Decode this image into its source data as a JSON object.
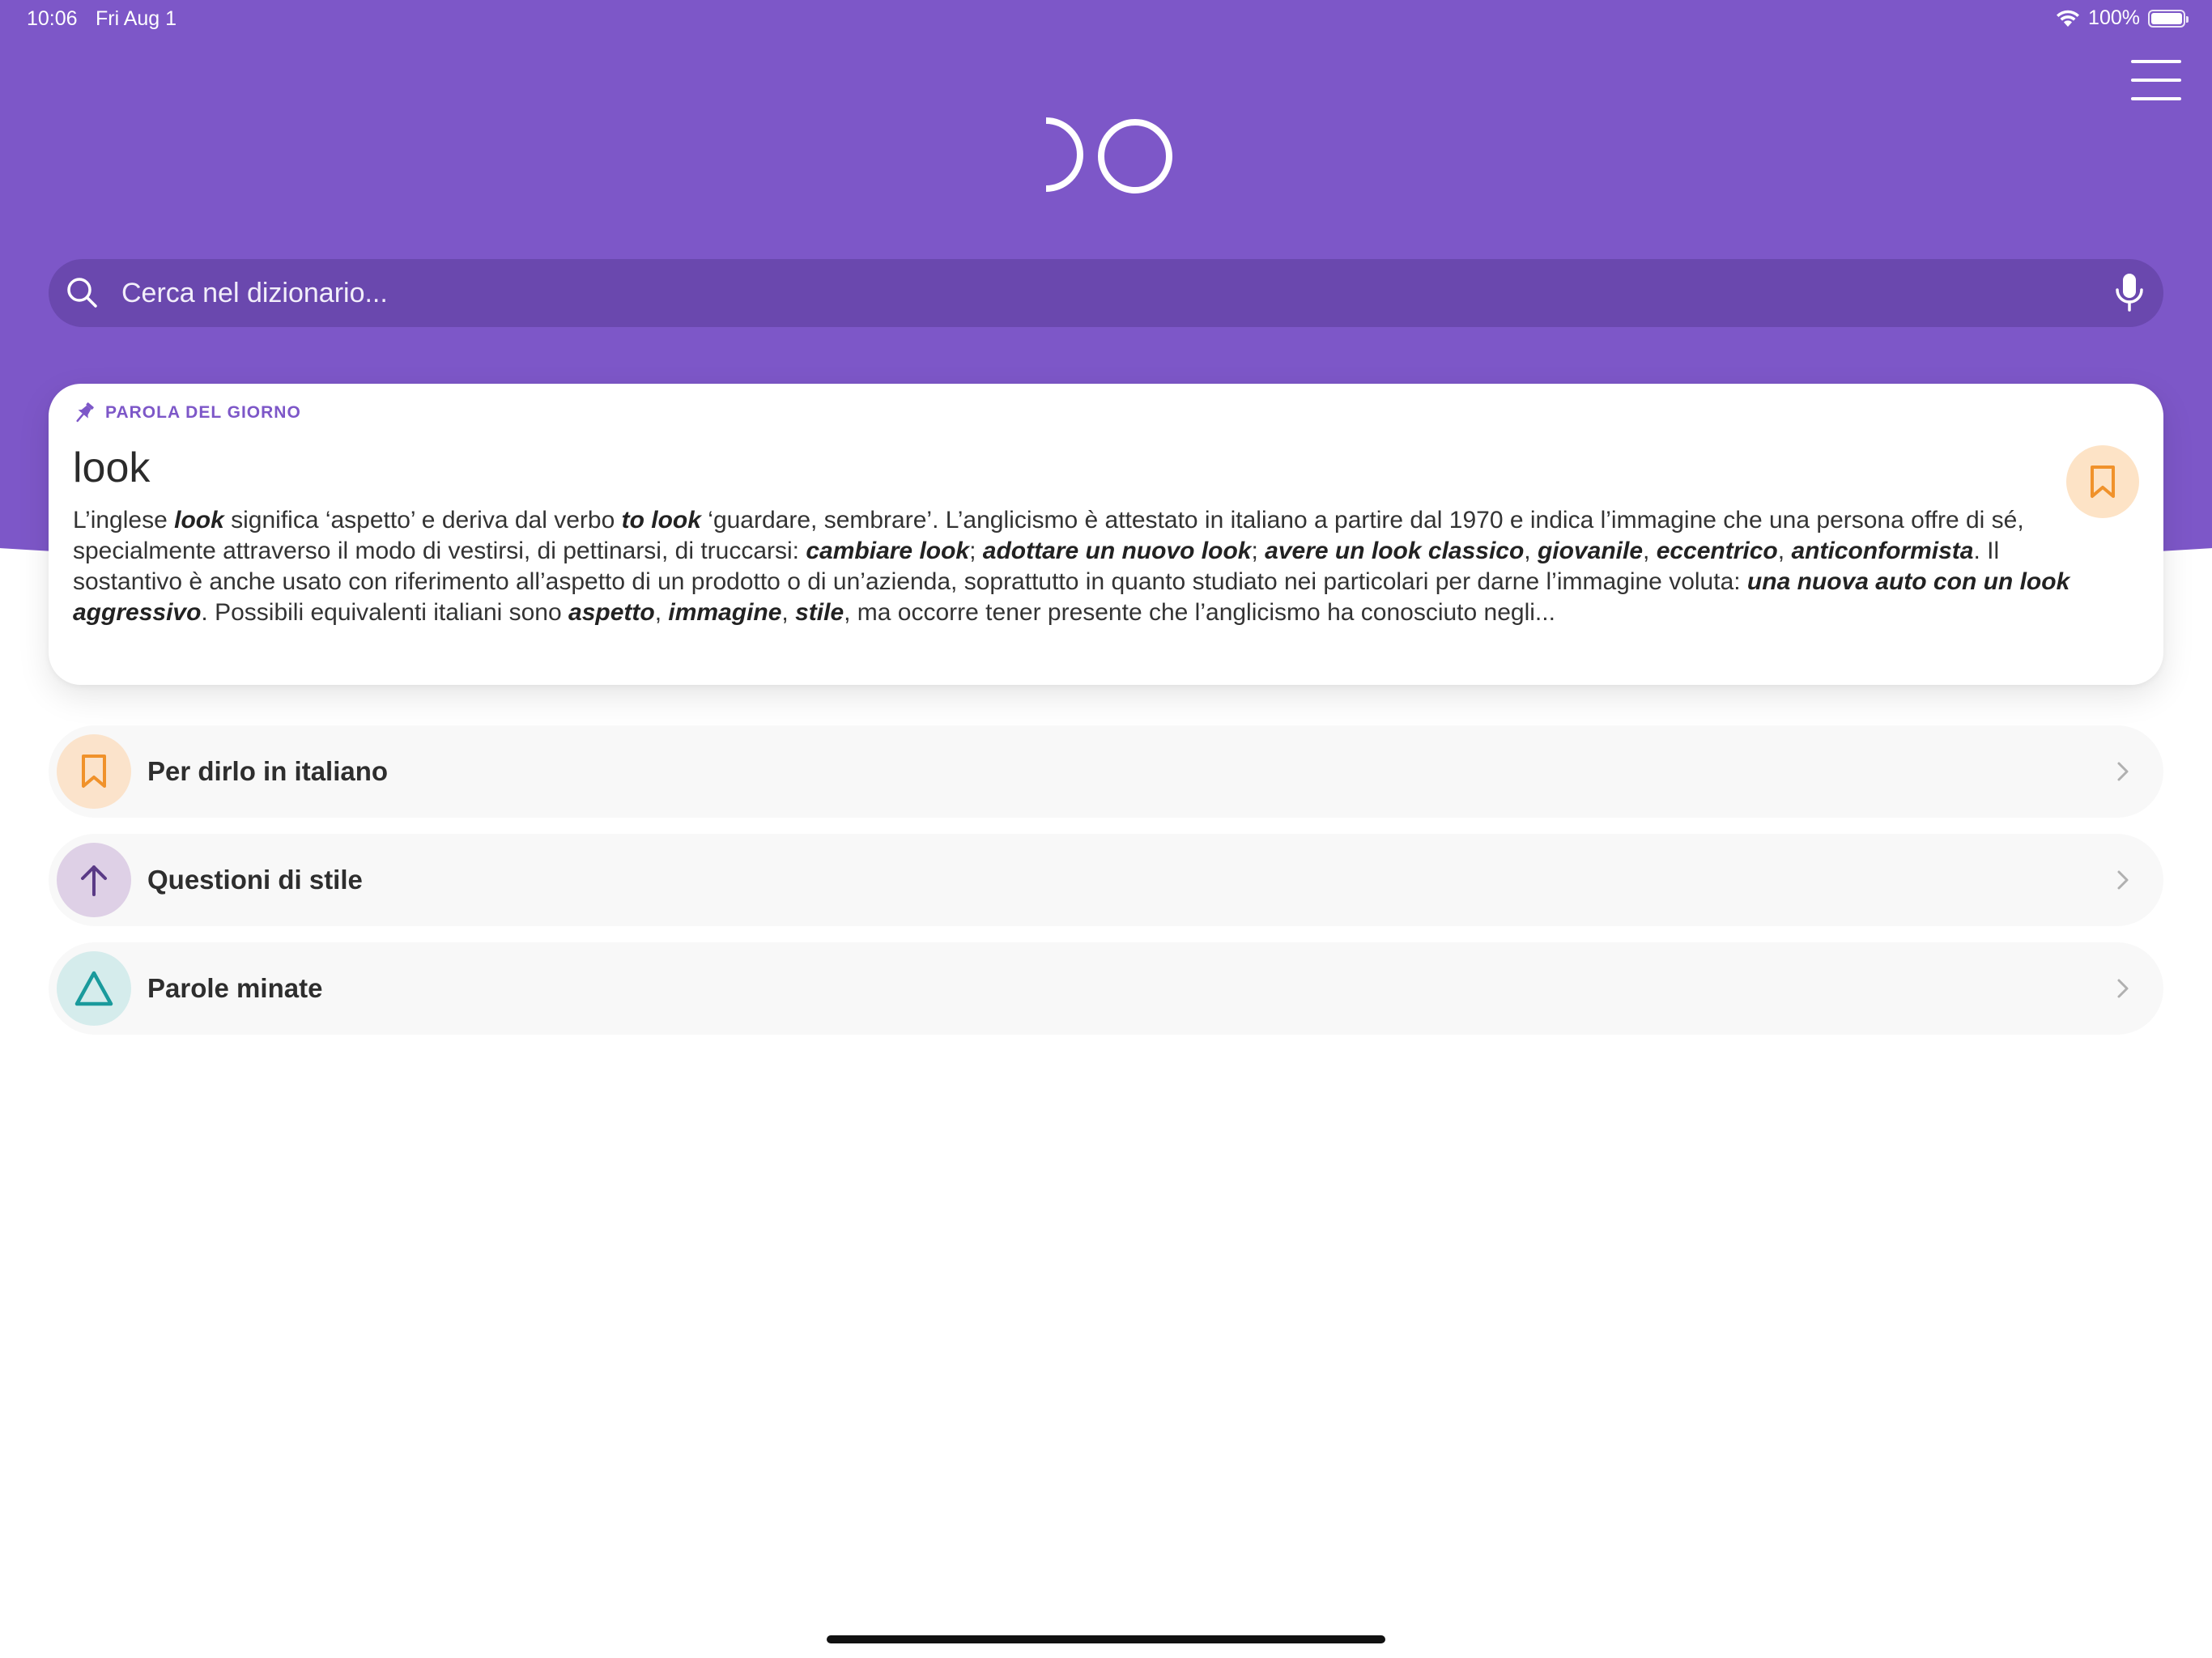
{
  "status_bar": {
    "time": "10:06",
    "date": "Fri Aug 1",
    "battery_text": "100%",
    "icons": [
      "wifi-icon",
      "battery-icon"
    ]
  },
  "header": {
    "menu_icon": "hamburger-menu-icon",
    "logo_icon": "app-logo"
  },
  "search": {
    "placeholder": "Cerca nel dizionario...",
    "value": "",
    "search_icon": "search-icon",
    "mic_icon": "microphone-icon"
  },
  "word_of_day": {
    "label": "PAROLA DEL GIORNO",
    "word": "look",
    "description_segments": [
      {
        "text": "L’inglese ",
        "bold": false
      },
      {
        "text": "look",
        "bold": true
      },
      {
        "text": " significa ‘aspetto’ e deriva dal verbo ",
        "bold": false
      },
      {
        "text": "to look",
        "bold": true
      },
      {
        "text": " ‘guardare, sembrare’. L’anglicismo è attestato in italiano a partire dal 1970 e indica l’immagine che una persona offre di sé, specialmente attraverso il modo di vestirsi, di pettinarsi, di truccarsi: ",
        "bold": false
      },
      {
        "text": "cambiare look",
        "bold": true
      },
      {
        "text": "; ",
        "bold": false
      },
      {
        "text": "adottare un nuovo look",
        "bold": true
      },
      {
        "text": "; ",
        "bold": false
      },
      {
        "text": "avere un look classico",
        "bold": true
      },
      {
        "text": ", ",
        "bold": false
      },
      {
        "text": "giovanile",
        "bold": true
      },
      {
        "text": ", ",
        "bold": false
      },
      {
        "text": "eccentrico",
        "bold": true
      },
      {
        "text": ", ",
        "bold": false
      },
      {
        "text": "anticonformista",
        "bold": true
      },
      {
        "text": ". Il sostantivo è anche usato con riferimento all’aspetto di un prodotto o di un’azienda, soprattutto in quanto studiato nei particolari per darne l’immagine voluta: ",
        "bold": false
      },
      {
        "text": "una nuova auto con un look aggressivo",
        "bold": true
      },
      {
        "text": ". Possibili equivalenti italiani sono ",
        "bold": false
      },
      {
        "text": "aspetto",
        "bold": true
      },
      {
        "text": ", ",
        "bold": false
      },
      {
        "text": "immagine",
        "bold": true
      },
      {
        "text": ", ",
        "bold": false
      },
      {
        "text": "stile",
        "bold": true
      },
      {
        "text": ", ma occorre tener presente che l’anglicismo ha conosciuto negli...",
        "bold": false
      }
    ],
    "bookmark_icon": "bookmark-icon"
  },
  "sections": [
    {
      "label": "Per dirlo in italiano",
      "icon": "bookmark-icon",
      "icon_color": "#f0922b",
      "circle_color": "#fbe3cb"
    },
    {
      "label": "Questioni di stile",
      "icon": "arrow-up-icon",
      "icon_color": "#5a3a86",
      "circle_color": "#ded0e6"
    },
    {
      "label": "Parole minate",
      "icon": "triangle-icon",
      "icon_color": "#1a9a9c",
      "circle_color": "#d5ecec"
    }
  ],
  "colors": {
    "header_purple": "#7d57c8",
    "search_purple": "#6a48ae",
    "accent_orange": "#f0922b"
  }
}
